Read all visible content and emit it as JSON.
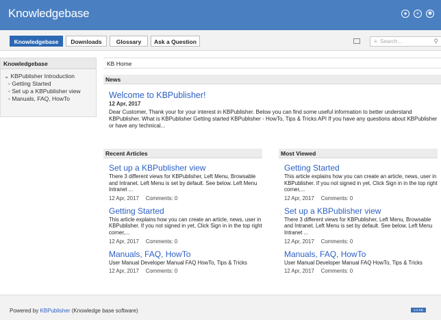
{
  "app": {
    "title": "Knowledgebase"
  },
  "top_icons": [
    "user-icon",
    "plus-icon",
    "settings-icon"
  ],
  "nav": {
    "tabs": [
      {
        "label": "Knowledgebase",
        "active": true
      },
      {
        "label": "Downloads",
        "active": false
      },
      {
        "label": "Glossary",
        "active": false
      },
      {
        "label": "Ask a Question",
        "active": false
      }
    ],
    "search_placeholder": "Search...",
    "search_menu_glyph": "≡"
  },
  "sidebar": {
    "title": "Knowledgebase",
    "items": [
      {
        "label": "KBPublisher Introduction",
        "prefix": "⌄ "
      },
      {
        "label": "Getting Started",
        "prefix": "◦ "
      },
      {
        "label": "Set up a KBPublisher view",
        "prefix": "◦ "
      },
      {
        "label": "Manuals, FAQ, HowTo",
        "prefix": "◦ "
      }
    ]
  },
  "main": {
    "breadcrumb": "KB Home",
    "news": {
      "heading": "News",
      "title": "Welcome to KBPublisher!",
      "date": "12 Apr, 2017",
      "body": "Dear Customer, Thank your for your interest in KBPublisher. Below you can find some useful information to better understand KBPublisher. What is KBPublisher Getting started KBPublisher - HowTo, Tips & Tricks API If you have any questions about KBPublisher or have any technical..."
    },
    "recent": {
      "heading": "Recent Articles",
      "articles": [
        {
          "title": "Set up a KBPublisher view",
          "text": "There 3 different views for KBPublisher, Left Menu, Browsable and Intranet. Left Menu is set by default. See below. Left Menu Intranet ...",
          "date": "12 Apr, 2017",
          "comments": "Comments: 0"
        },
        {
          "title": "Getting Started",
          "text": "This article explains how you can create an article, news, user in KBPublisher. If you not signed in yet, Click Sign in in the top right corner,...",
          "date": "12 Apr, 2017",
          "comments": "Comments: 0"
        },
        {
          "title": "Manuals, FAQ, HowTo",
          "text": "User Manual Developer Manual FAQ HowTo, Tips & Tricks",
          "date": "12 Apr, 2017",
          "comments": "Comments: 0"
        }
      ]
    },
    "viewed": {
      "heading": "Most Viewed",
      "articles": [
        {
          "title": "Getting Started",
          "text": "This article explains how you can create an article, news, user in KBPublisher. If you not signed in yet, Click Sign in in the top right corner,...",
          "date": "12 Apr, 2017",
          "comments": "Comments: 0"
        },
        {
          "title": "Set up a KBPublisher view",
          "text": "There 3 different views for KBPublisher, Left Menu, Browsable and Intranet. Left Menu is set by default. See below. Left Menu Intranet ...",
          "date": "12 Apr, 2017",
          "comments": "Comments: 0"
        },
        {
          "title": "Manuals, FAQ, HowTo",
          "text": "User Manual Developer Manual FAQ HowTo, Tips & Tricks",
          "date": "12 Apr, 2017",
          "comments": "Comments: 0"
        }
      ]
    }
  },
  "footer": {
    "prefix": "Powered by ",
    "link": "KBPublisher",
    "suffix": " (Knowledge base software)",
    "badge": "2.0 KB"
  },
  "colors": {
    "header": "#4a7fc1",
    "accent": "#2c68b3",
    "link": "#2c5fc4"
  }
}
